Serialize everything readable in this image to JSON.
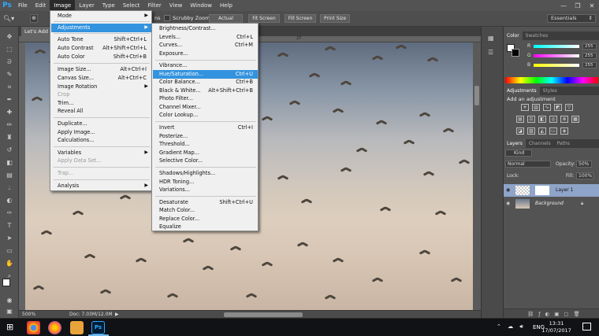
{
  "menubar": {
    "logo": "Ps",
    "items": [
      "File",
      "Edit",
      "Image",
      "Layer",
      "Type",
      "Select",
      "Filter",
      "View",
      "Window",
      "Help"
    ],
    "active": "Image"
  },
  "window_controls": {
    "minimize": "—",
    "restore": "❐",
    "close": "✕"
  },
  "options_bar": {
    "scrubby_zoom_label": "Scrubby Zoom",
    "actual_pixels": "Actual Pixels",
    "fit_screen": "Fit Screen",
    "fill_screen": "Fill Screen",
    "print_size": "Print Size",
    "workspace": "Essentials",
    "partial_label": "ns"
  },
  "document": {
    "tab_label": "Let's Add Bl",
    "ruler_tick": "27",
    "zoom": "500%",
    "doc_info": "Doc: 7.03M/12.0M"
  },
  "image_menu": {
    "items": [
      {
        "label": "Mode",
        "shortcut": "",
        "arrow": true
      },
      {
        "label": "Adjustments",
        "shortcut": "",
        "arrow": true,
        "highlight": true
      },
      {
        "label": "Auto Tone",
        "shortcut": "Shift+Ctrl+L"
      },
      {
        "label": "Auto Contrast",
        "shortcut": "Alt+Shift+Ctrl+L"
      },
      {
        "label": "Auto Color",
        "shortcut": "Shift+Ctrl+B"
      },
      {
        "label": "Image Size...",
        "shortcut": "Alt+Ctrl+I"
      },
      {
        "label": "Canvas Size...",
        "shortcut": "Alt+Ctrl+C"
      },
      {
        "label": "Image Rotation",
        "shortcut": "",
        "arrow": true
      },
      {
        "label": "Crop",
        "shortcut": "",
        "disabled": true
      },
      {
        "label": "Trim...",
        "shortcut": ""
      },
      {
        "label": "Reveal All",
        "shortcut": ""
      },
      {
        "label": "Duplicate...",
        "shortcut": ""
      },
      {
        "label": "Apply Image...",
        "shortcut": ""
      },
      {
        "label": "Calculations...",
        "shortcut": ""
      },
      {
        "label": "Variables",
        "shortcut": "",
        "arrow": true
      },
      {
        "label": "Apply Data Set...",
        "shortcut": "",
        "disabled": true
      },
      {
        "label": "Trap...",
        "shortcut": "",
        "disabled": true
      },
      {
        "label": "Analysis",
        "shortcut": "",
        "arrow": true
      }
    ]
  },
  "adjustments_menu": {
    "items": [
      {
        "label": "Brightness/Contrast...",
        "shortcut": ""
      },
      {
        "label": "Levels...",
        "shortcut": "Ctrl+L"
      },
      {
        "label": "Curves...",
        "shortcut": "Ctrl+M"
      },
      {
        "label": "Exposure...",
        "shortcut": ""
      },
      {
        "label": "Vibrance...",
        "shortcut": ""
      },
      {
        "label": "Hue/Saturation...",
        "shortcut": "Ctrl+U",
        "highlight": true
      },
      {
        "label": "Color Balance...",
        "shortcut": "Ctrl+B"
      },
      {
        "label": "Black & White...",
        "shortcut": "Alt+Shift+Ctrl+B"
      },
      {
        "label": "Photo Filter...",
        "shortcut": ""
      },
      {
        "label": "Channel Mixer...",
        "shortcut": ""
      },
      {
        "label": "Color Lookup...",
        "shortcut": ""
      },
      {
        "label": "Invert",
        "shortcut": "Ctrl+I"
      },
      {
        "label": "Posterize...",
        "shortcut": ""
      },
      {
        "label": "Threshold...",
        "shortcut": ""
      },
      {
        "label": "Gradient Map...",
        "shortcut": ""
      },
      {
        "label": "Selective Color...",
        "shortcut": ""
      },
      {
        "label": "Shadows/Highlights...",
        "shortcut": ""
      },
      {
        "label": "HDR Toning...",
        "shortcut": ""
      },
      {
        "label": "Variations...",
        "shortcut": ""
      },
      {
        "label": "Desaturate",
        "shortcut": "Shift+Ctrl+U"
      },
      {
        "label": "Match Color...",
        "shortcut": ""
      },
      {
        "label": "Replace Color...",
        "shortcut": ""
      },
      {
        "label": "Equalize",
        "shortcut": ""
      }
    ]
  },
  "color_panel": {
    "tabs": [
      "Color",
      "Swatches"
    ],
    "r": "255",
    "g": "255",
    "b": "255",
    "r_label": "R",
    "g_label": "G",
    "b_label": "B"
  },
  "adjustments_panel": {
    "tabs": [
      "Adjustments",
      "Styles"
    ],
    "title": "Add an adjustment"
  },
  "layers_panel": {
    "tabs": [
      "Layers",
      "Channels",
      "Paths"
    ],
    "filter": "Kind",
    "blend_mode": "Normal",
    "opacity_label": "Opacity:",
    "opacity": "50%",
    "lock_label": "Lock:",
    "fill_label": "Fill:",
    "fill": "100%",
    "layers": [
      {
        "name": "Layer 1",
        "selected": true
      },
      {
        "name": "Background",
        "locked": true
      }
    ]
  },
  "taskbar": {
    "language": "ENG",
    "time": "13:31",
    "date": "17/07/2017"
  },
  "colors": {
    "accent": "#3393df",
    "menubar": "#535353",
    "photoshop_blue": "#31a8ff"
  }
}
